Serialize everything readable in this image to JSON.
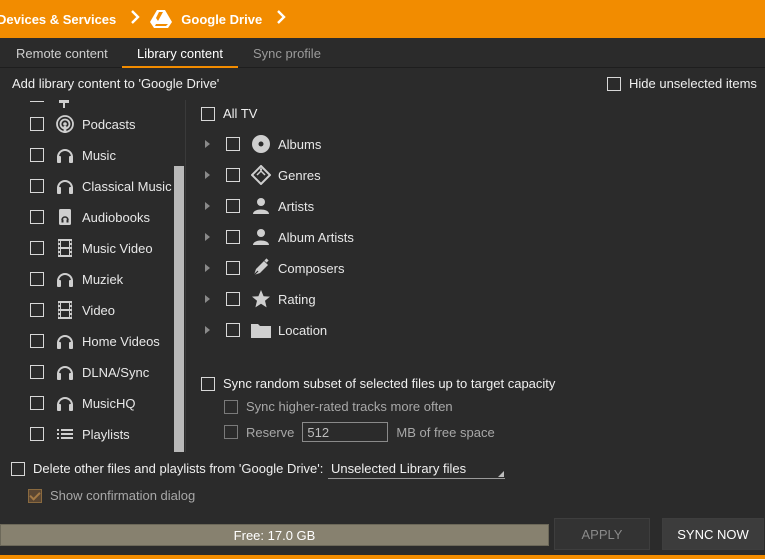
{
  "breadcrumb": {
    "first": "Devices & Services",
    "second": "Google Drive"
  },
  "tabs": [
    {
      "label": "Remote content"
    },
    {
      "label": "Library content"
    },
    {
      "label": "Sync profile"
    }
  ],
  "heading": "Add library content to 'Google Drive'",
  "hide_unselected": "Hide unselected items",
  "left_items": [
    {
      "label": "Podcasts",
      "icon": "podcast-icon"
    },
    {
      "label": "Music",
      "icon": "headphones-icon"
    },
    {
      "label": "Classical Music",
      "icon": "headphones-icon"
    },
    {
      "label": "Audiobooks",
      "icon": "audiobook-icon"
    },
    {
      "label": "Music Video",
      "icon": "film-icon"
    },
    {
      "label": "Muziek",
      "icon": "headphones-icon"
    },
    {
      "label": "Video",
      "icon": "film-icon"
    },
    {
      "label": "Home Videos",
      "icon": "headphones-icon"
    },
    {
      "label": "DLNA/Sync",
      "icon": "headphones-icon"
    },
    {
      "label": "MusicHQ",
      "icon": "headphones-icon"
    },
    {
      "label": "Playlists",
      "icon": "playlist-icon"
    }
  ],
  "tree": {
    "root": "All TV",
    "items": [
      {
        "label": "Albums",
        "icon": "disc-icon"
      },
      {
        "label": "Genres",
        "icon": "tag-icon"
      },
      {
        "label": "Artists",
        "icon": "person-icon"
      },
      {
        "label": "Album Artists",
        "icon": "person-icon"
      },
      {
        "label": "Composers",
        "icon": "pen-icon"
      },
      {
        "label": "Rating",
        "icon": "star-icon"
      },
      {
        "label": "Location",
        "icon": "folder-icon"
      }
    ]
  },
  "sync_random": "Sync random subset of selected files up to target capacity",
  "sync_higher": "Sync higher-rated tracks more often",
  "reserve": {
    "label": "Reserve",
    "value": "512",
    "unit": "MB of free space"
  },
  "delete_other": "Delete other files and playlists from 'Google Drive':",
  "delete_dropdown": "Unselected Library files",
  "show_confirmation": "Show confirmation dialog",
  "capacity": "Free: 17.0 GB",
  "buttons": {
    "apply": "APPLY",
    "sync_now": "SYNC NOW"
  },
  "colors": {
    "accent": "#f28c00",
    "background": "#2b2b2b",
    "capacity_bar": "#87816f"
  }
}
